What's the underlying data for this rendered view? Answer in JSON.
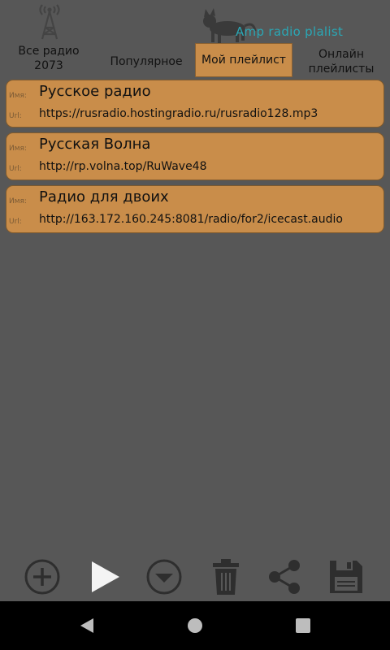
{
  "header": {
    "app_title": "Amp radio plalist",
    "tabs": {
      "all_line1": "Все радио",
      "all_line2": "2073",
      "popular": "Популярное",
      "my_playlist": "Мой плейлист",
      "online_line1": "Онлайн",
      "online_line2": "плейлисты"
    }
  },
  "labels": {
    "name": "Имя:",
    "url": "Url:"
  },
  "stations": [
    {
      "name": "Русское радио",
      "url": "https://rusradio.hostingradio.ru/rusradio128.mp3"
    },
    {
      "name": "Русская Волна",
      "url": "http://rp.volna.top/RuWave48"
    },
    {
      "name": "Радио для двоих",
      "url": "http://163.172.160.245:8081/radio/for2/icecast.audio"
    }
  ],
  "toolbar": {
    "icons": [
      "add-icon",
      "play-icon",
      "dropdown-icon",
      "trash-icon",
      "share-icon",
      "save-icon"
    ]
  },
  "colors": {
    "background": "#575757",
    "accent": "#c98d4a",
    "title": "#2aa7b5"
  }
}
